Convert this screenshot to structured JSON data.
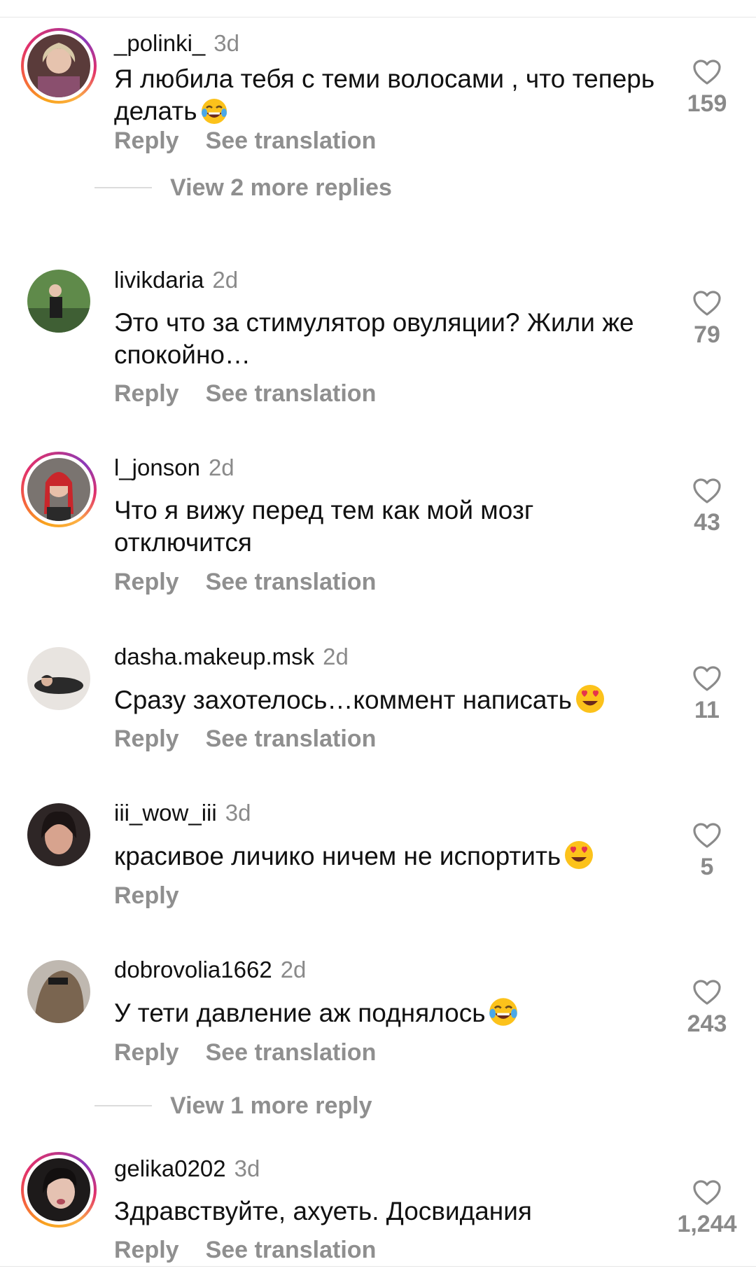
{
  "comments": [
    {
      "username": "_polinki_",
      "time": "3d",
      "text": "Я любила тебя с теми волосами , что теперь делать",
      "emoji": "joy",
      "reply": "Reply",
      "translate": "See translation",
      "likes": "159",
      "view_more": "View 2 more replies",
      "story": true
    },
    {
      "username": "livikdaria",
      "time": "2d",
      "text": "Это что за стимулятор овуляции? Жили же спокойно…",
      "emoji": "",
      "reply": "Reply",
      "translate": "See translation",
      "likes": "79",
      "story": false
    },
    {
      "username": "l_jonson",
      "time": "2d",
      "text": "Что я вижу перед тем как мой мозг отключится",
      "emoji": "",
      "reply": "Reply",
      "translate": "See translation",
      "likes": "43",
      "story": true
    },
    {
      "username": "dasha.makeup.msk",
      "time": "2d",
      "text": "Сразу захотелось…коммент написать",
      "emoji": "heart-eyes",
      "reply": "Reply",
      "translate": "See translation",
      "likes": "11",
      "story": false
    },
    {
      "username": "iii_wow_iii",
      "time": "3d",
      "text": "красивое личико ничем не испортить",
      "emoji": "heart-eyes",
      "reply": "Reply",
      "likes": "5",
      "story": false
    },
    {
      "username": "dobrovolia1662",
      "time": "2d",
      "text": "У тети давление аж поднялось",
      "emoji": "joy",
      "reply": "Reply",
      "translate": "See translation",
      "likes": "243",
      "view_more": "View 1 more reply",
      "story": false
    },
    {
      "username": "gelika0202",
      "time": "3d",
      "text": "Здравствуйте, ахуеть. Досвидания",
      "emoji": "",
      "reply": "Reply",
      "translate": "See translation",
      "likes": "1,244",
      "story": true
    }
  ],
  "colors": {
    "text": "#111111",
    "muted": "#8f8f8f",
    "divider": "#e6e6e6"
  },
  "icons": {
    "like": "heart-outline-icon"
  }
}
